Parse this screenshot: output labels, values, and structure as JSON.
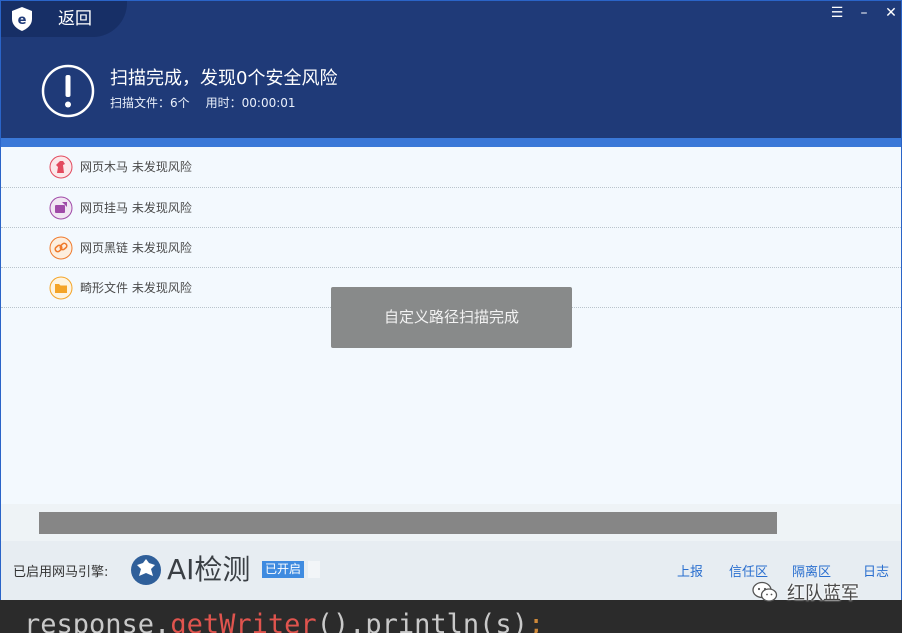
{
  "header": {
    "back_label": "返回",
    "title": "扫描完成，发现0个安全风险",
    "files_scanned": "扫描文件：6个",
    "elapsed": "用时：00:00:01",
    "window_controls": [
      "menu-icon",
      "minimize-icon",
      "close-icon"
    ]
  },
  "results": [
    {
      "label": "网页木马 未发现风险",
      "icon": "trojan-horse-icon",
      "color": "#e34a5e"
    },
    {
      "label": "网页挂马 未发现风险",
      "icon": "hijack-icon",
      "color": "#a04aa8"
    },
    {
      "label": "网页黑链 未发现风险",
      "icon": "dark-link-icon",
      "color": "#ef7a2c"
    },
    {
      "label": "畸形文件 未发现风险",
      "icon": "folder-icon",
      "color": "#f4a428"
    }
  ],
  "toast": {
    "text": "自定义路径扫描完成"
  },
  "footer": {
    "engine_label": "已启用网马引擎:",
    "ai_text": "AI检测",
    "ai_status": "已开启",
    "links": [
      "上报",
      "信任区",
      "隔离区",
      "日志"
    ]
  },
  "code_strip": {
    "prefix": "response.",
    "method": "getWriter",
    "suffix": "().println(s)",
    "end": ";"
  },
  "watermark": {
    "text": "红队蓝军"
  },
  "colors": {
    "header_bg": "#1f3a78",
    "accent": "#3a78d8",
    "link": "#2a6fcf"
  }
}
